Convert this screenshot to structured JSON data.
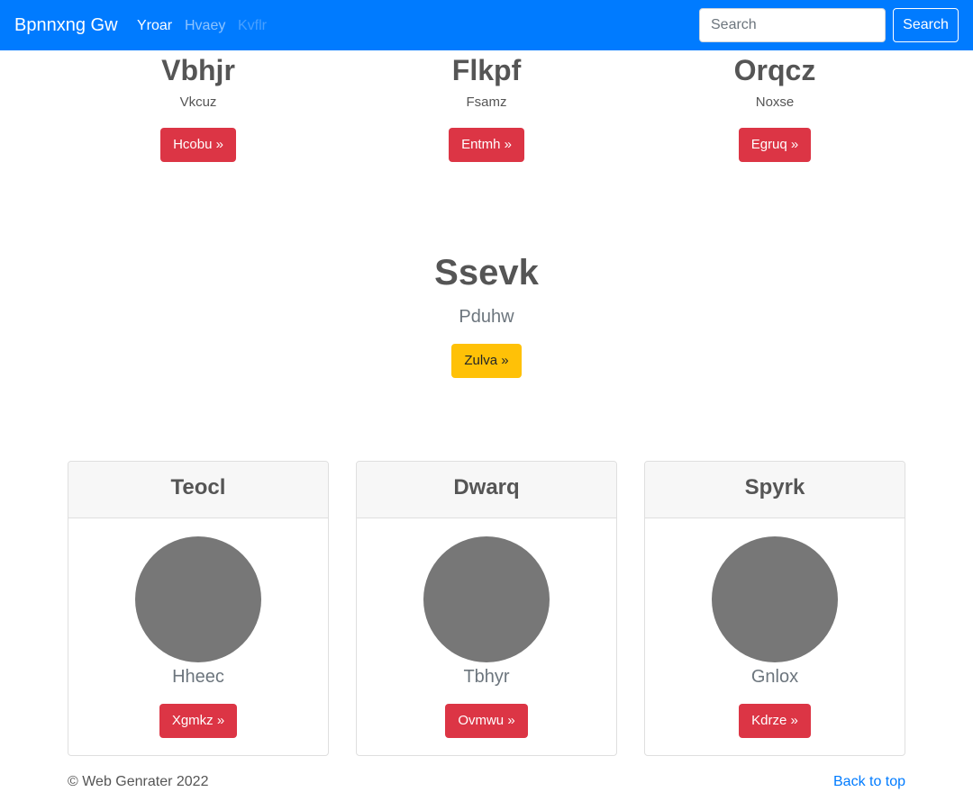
{
  "navbar": {
    "brand": "Bpnnxng Gw",
    "links": [
      "Yroar",
      "Hvaey",
      "Kvflr"
    ],
    "search_placeholder": "Search",
    "search_button": "Search"
  },
  "columns": [
    {
      "title": "Vbhjr",
      "text": "Vkcuz",
      "button": "Hcobu »"
    },
    {
      "title": "Flkpf",
      "text": "Fsamz",
      "button": "Entmh »"
    },
    {
      "title": "Orqcz",
      "text": "Noxse",
      "button": "Egruq »"
    }
  ],
  "hero": {
    "title": "Ssevk",
    "text": "Pduhw",
    "button": "Zulva »"
  },
  "cards": [
    {
      "header": "Teocl",
      "name": "Hheec",
      "button": "Xgmkz »"
    },
    {
      "header": "Dwarq",
      "name": "Tbhyr",
      "button": "Ovmwu »"
    },
    {
      "header": "Spyrk",
      "name": "Gnlox",
      "button": "Kdrze »"
    }
  ],
  "footer": {
    "copyright": "© Web Genrater 2022",
    "back_to_top": "Back to top"
  },
  "colors": {
    "primary": "#007bff",
    "danger": "#dc3545",
    "warning": "#ffc107",
    "avatar": "#777777"
  }
}
